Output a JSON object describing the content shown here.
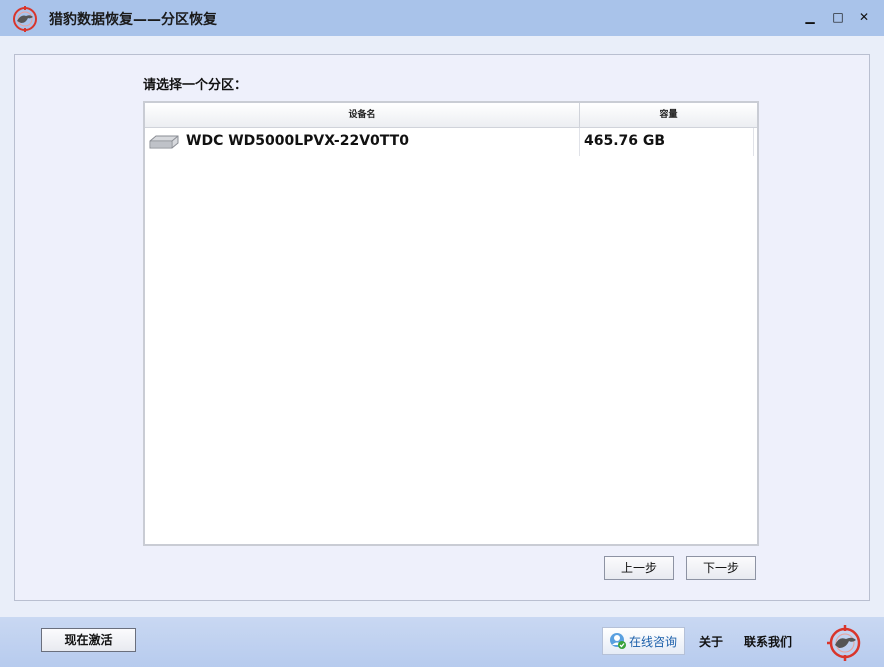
{
  "window": {
    "title": "猎豹数据恢复——分区恢复",
    "minimize_icon": "minimize-icon",
    "maximize_icon": "maximize-icon",
    "close_icon": "close-icon",
    "min_glyph": "▁",
    "max_glyph": "□",
    "close_glyph": "✕"
  },
  "main": {
    "prompt": "请选择一个分区：",
    "table": {
      "columns": [
        "设备名",
        "容量"
      ],
      "rows": [
        {
          "device": "WDC WD5000LPVX-22V0TT0",
          "capacity": "465.76 GB",
          "icon": "hard-drive-icon"
        }
      ]
    },
    "prev_button": "上一步",
    "next_button": "下一步"
  },
  "footer": {
    "activate_button": "现在激活",
    "consult_label": "在线咨询",
    "about_link": "关于",
    "contact_link": "联系我们"
  },
  "colors": {
    "titlebar": "#a9c3ea",
    "accent_red": "#d9352b",
    "link_blue": "#1b5faa"
  }
}
